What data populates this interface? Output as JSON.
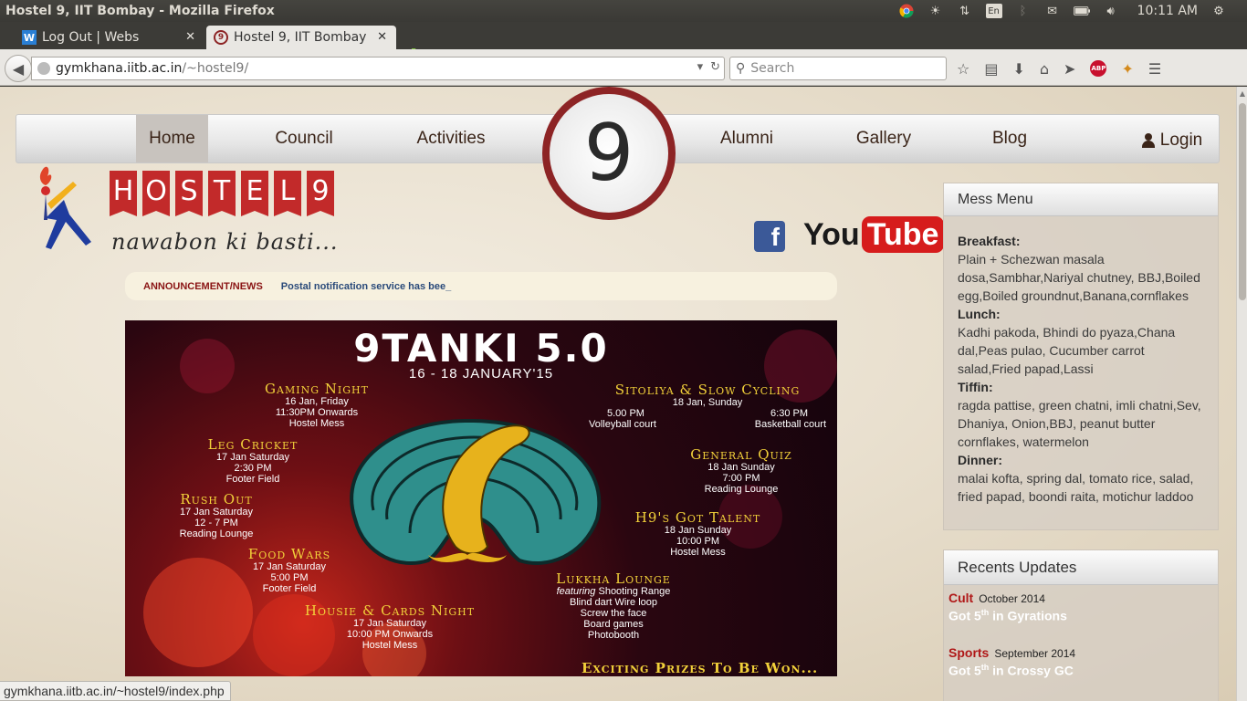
{
  "window": {
    "title": "Hostel 9, IIT Bombay - Mozilla Firefox"
  },
  "system_tray": {
    "lang": "En",
    "time": "10:11 AM"
  },
  "tabs": [
    {
      "label": "Log Out | Webs",
      "favicon": "W"
    },
    {
      "label": "Hostel 9, IIT Bombay",
      "favicon": "9"
    }
  ],
  "address_bar": {
    "host": "gymkhana.iitb.ac.in",
    "path": "/~hostel9/"
  },
  "search_bar": {
    "placeholder": "Search"
  },
  "site_nav": {
    "items": [
      "Home",
      "Council",
      "Activities",
      "Alumni",
      "Gallery",
      "Blog"
    ],
    "login": "Login",
    "emblem": "9"
  },
  "logo": {
    "letters": [
      "H",
      "O",
      "S",
      "T",
      "E",
      "L",
      "9"
    ],
    "tagline": "nawabon ki basti..."
  },
  "social": {
    "facebook": "f",
    "youtube_you": "You",
    "youtube_tube": "Tube"
  },
  "announcement": {
    "label": "ANNOUNCEMENT/NEWS",
    "text": "Postal notification service has bee_"
  },
  "poster": {
    "title": "9TANKI 5.0",
    "dates": "16 - 18 JANUARY'15",
    "events_left": [
      {
        "name": "Gaming Night",
        "lines": [
          "16 Jan, Friday",
          "11:30PM Onwards",
          "Hostel Mess"
        ]
      },
      {
        "name": "Leg Cricket",
        "lines": [
          "17 Jan Saturday",
          "2:30 PM",
          "Footer Field"
        ]
      },
      {
        "name": "Rush Out",
        "lines": [
          "17 Jan Saturday",
          "12 - 7  PM",
          "Reading Lounge"
        ]
      },
      {
        "name": "Food Wars",
        "lines": [
          "17 Jan Saturday",
          "5:00 PM",
          "Footer Field"
        ]
      },
      {
        "name": "Housie & Cards Night",
        "lines": [
          "17 Jan Saturday",
          "10:00 PM Onwards",
          "Hostel Mess"
        ]
      }
    ],
    "sitoliya": {
      "name": "Sitoliya  &  Slow Cycling",
      "date": "18 Jan, Sunday",
      "time1": "5.00 PM",
      "time2": "6:30 PM",
      "place1": "Volleyball court",
      "place2": "Basketball court"
    },
    "events_right": [
      {
        "name": "General Quiz",
        "lines": [
          "18 Jan Sunday",
          "7:00 PM",
          "Reading Lounge"
        ]
      },
      {
        "name": "H9's Got Talent",
        "lines": [
          "18 Jan Sunday",
          "10:00 PM",
          "Hostel Mess"
        ]
      }
    ],
    "lukkha": {
      "name": "Lukkha Lounge",
      "featuring": "featuring",
      "lines": [
        "Shooting Range",
        "Blind dart  Wire loop",
        "Screw the face",
        "Board games",
        "Photobooth"
      ]
    },
    "footer": "Exciting Prizes To Be Won..."
  },
  "mess_menu": {
    "title": "Mess Menu",
    "meals": [
      {
        "label": "Breakfast:",
        "items": "Plain + Schezwan masala dosa,Sambhar,Nariyal chutney, BBJ,Boiled egg,Boiled groundnut,Banana,cornflakes"
      },
      {
        "label": "Lunch:",
        "items": "Kadhi pakoda, Bhindi do pyaza,Chana dal,Peas pulao, Cucumber carrot salad,Fried papad,Lassi"
      },
      {
        "label": "Tiffin:",
        "items": "ragda pattise, green chatni, imli chatni,Sev, Dhaniya, Onion,BBJ, peanut butter cornflakes, watermelon"
      },
      {
        "label": "Dinner:",
        "items": "malai kofta, spring dal, tomato rice, salad, fried papad, boondi raita, motichur laddoo"
      }
    ]
  },
  "recent_updates": {
    "title": "Recents Updates",
    "items": [
      {
        "category": "Cult",
        "date": "October 2014",
        "text_pre": "Got 5",
        "sup": "th",
        "text_post": " in Gyrations"
      },
      {
        "category": "Sports",
        "date": "September 2014",
        "text_pre": "Got 5",
        "sup": "th",
        "text_post": " in Crossy GC"
      }
    ]
  },
  "status_bar": {
    "url": "gymkhana.iitb.ac.in/~hostel9/index.php"
  },
  "colors": {
    "brand_red": "#c22a2a",
    "emblem_ring": "#8d2425",
    "poster_yellow": "#f2d13a",
    "update_category": "#b01818"
  }
}
